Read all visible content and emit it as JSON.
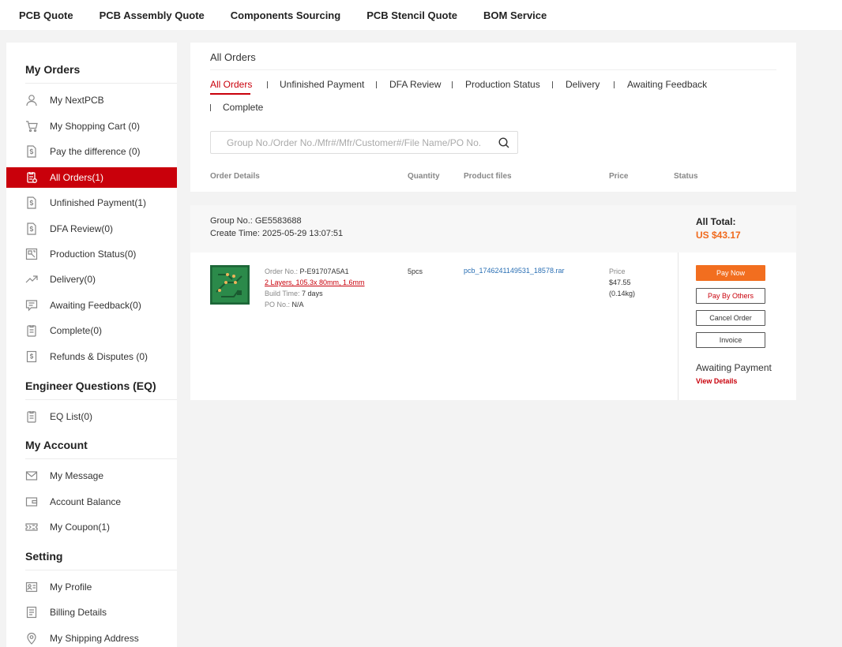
{
  "topnav": [
    "PCB Quote",
    "PCB Assembly Quote",
    "Components Sourcing",
    "PCB Stencil Quote",
    "BOM Service"
  ],
  "sidebar": {
    "my_orders": {
      "title": "My Orders",
      "items": [
        {
          "label": "My NextPCB",
          "icon": "user-icon"
        },
        {
          "label": "My Shopping Cart (0)",
          "icon": "cart-icon"
        },
        {
          "label": "Pay the difference (0)",
          "icon": "dollar-doc-icon"
        },
        {
          "label": "All Orders(1)",
          "icon": "orders-icon",
          "active": true
        },
        {
          "label": "Unfinished Payment(1)",
          "icon": "dollar-doc-icon"
        },
        {
          "label": "DFA Review(0)",
          "icon": "dollar-doc-icon"
        },
        {
          "label": "Production Status(0)",
          "icon": "production-icon"
        },
        {
          "label": "Delivery(0)",
          "icon": "delivery-icon"
        },
        {
          "label": "Awaiting Feedback(0)",
          "icon": "feedback-icon"
        },
        {
          "label": "Complete(0)",
          "icon": "clipboard-icon"
        },
        {
          "label": "Refunds & Disputes (0)",
          "icon": "refund-icon"
        }
      ]
    },
    "eq": {
      "title": "Engineer Questions (EQ)",
      "items": [
        {
          "label": "EQ List(0)",
          "icon": "clipboard-icon"
        }
      ]
    },
    "account": {
      "title": "My Account",
      "items": [
        {
          "label": "My Message",
          "icon": "mail-icon"
        },
        {
          "label": "Account Balance",
          "icon": "wallet-icon"
        },
        {
          "label": "My Coupon(1)",
          "icon": "coupon-icon"
        }
      ]
    },
    "setting": {
      "title": "Setting",
      "items": [
        {
          "label": "My Profile",
          "icon": "profile-icon"
        },
        {
          "label": "Billing Details",
          "icon": "billing-icon"
        },
        {
          "label": "My Shipping Address",
          "icon": "location-icon"
        }
      ]
    }
  },
  "main": {
    "title": "All Orders",
    "tabs": [
      "All Orders",
      "Unfinished Payment",
      "DFA Review",
      "Production Status",
      "Delivery",
      "Awaiting Feedback",
      "Complete"
    ],
    "search_placeholder": "Group No./Order No./Mfr#/Mfr/Customer#/File Name/PO No.",
    "columns": [
      "Order Details",
      "Quantity",
      "Product files",
      "Price",
      "Status"
    ]
  },
  "order": {
    "group_no": "Group No.: GE5583688",
    "create_time": "Create Time: 2025-05-29 13:07:51",
    "total_label": "All Total:",
    "total_value": "US $43.17",
    "order_no_label": "Order No.:",
    "order_no": "P-E91707A5A1",
    "spec": "2 Layers, 105.3x 80mm, 1.6mm",
    "build_time_label": "Build Time:",
    "build_time": "7 days",
    "po_label": "PO No.:",
    "po": "N/A",
    "quantity": "5pcs",
    "file": "pcb_1746241149531_18578.rar",
    "price_label": "Price",
    "price": "$47.55",
    "weight": "(0.14kg)",
    "buttons": {
      "pay_now": "Pay Now",
      "pay_by_others": "Pay By Others",
      "cancel": "Cancel Order",
      "invoice": "Invoice"
    },
    "status": "Awaiting Payment",
    "view_details": "View Details"
  },
  "colors": {
    "brand_red": "#c9000b",
    "accent_orange": "#f26e1f",
    "link_blue": "#2a6fb4"
  }
}
